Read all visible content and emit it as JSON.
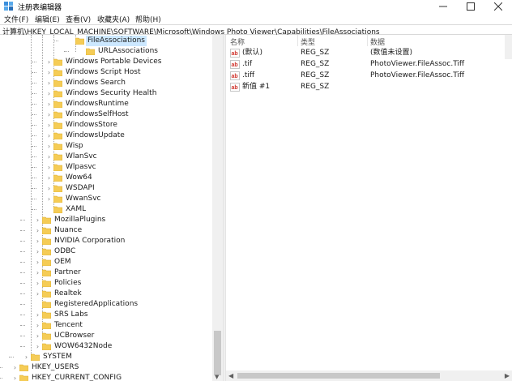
{
  "window": {
    "title": "注册表编辑器",
    "minimize_glyph": "—",
    "maximize_glyph": "☐",
    "close_glyph": "✕"
  },
  "menu": [
    "文件(F)",
    "编辑(E)",
    "查看(V)",
    "收藏夹(A)",
    "帮助(H)"
  ],
  "address": "计算机\\HKEY_LOCAL_MACHINE\\SOFTWARE\\Microsoft\\Windows Photo Viewer\\Capabilities\\FileAssociations",
  "tree": {
    "selected": "FileAssociations",
    "items": [
      {
        "label": "FileAssociations",
        "expander": ""
      },
      {
        "label": "URLAssociations",
        "expander": ""
      },
      {
        "label": "Windows Portable Devices",
        "expander": "›"
      },
      {
        "label": "Windows Script Host",
        "expander": "›"
      },
      {
        "label": "Windows Search",
        "expander": "›"
      },
      {
        "label": "Windows Security Health",
        "expander": "›"
      },
      {
        "label": "WindowsRuntime",
        "expander": "›"
      },
      {
        "label": "WindowsSelfHost",
        "expander": "›"
      },
      {
        "label": "WindowsStore",
        "expander": "›"
      },
      {
        "label": "WindowsUpdate",
        "expander": "›"
      },
      {
        "label": "Wisp",
        "expander": "›"
      },
      {
        "label": "WlanSvc",
        "expander": "›"
      },
      {
        "label": "Wlpasvc",
        "expander": "›"
      },
      {
        "label": "Wow64",
        "expander": "›"
      },
      {
        "label": "WSDAPI",
        "expander": "›"
      },
      {
        "label": "WwanSvc",
        "expander": "›"
      },
      {
        "label": "XAML",
        "expander": ""
      },
      {
        "label": "MozillaPlugins",
        "expander": "›"
      },
      {
        "label": "Nuance",
        "expander": "›"
      },
      {
        "label": "NVIDIA Corporation",
        "expander": "›"
      },
      {
        "label": "ODBC",
        "expander": "›"
      },
      {
        "label": "OEM",
        "expander": "›"
      },
      {
        "label": "Partner",
        "expander": "›"
      },
      {
        "label": "Policies",
        "expander": "›"
      },
      {
        "label": "Realtek",
        "expander": "›"
      },
      {
        "label": "RegisteredApplications",
        "expander": ""
      },
      {
        "label": "SRS Labs",
        "expander": "›"
      },
      {
        "label": "Tencent",
        "expander": "›"
      },
      {
        "label": "UCBrowser",
        "expander": "›"
      },
      {
        "label": "WOW6432Node",
        "expander": "›"
      },
      {
        "label": "SYSTEM",
        "expander": "›"
      },
      {
        "label": "HKEY_USERS",
        "expander": "›"
      },
      {
        "label": "HKEY_CURRENT_CONFIG",
        "expander": "›"
      }
    ]
  },
  "columns": {
    "name": "名称",
    "type": "类型",
    "data": "数据"
  },
  "values": [
    {
      "name": "(默认)",
      "type": "REG_SZ",
      "data": "(数值未设置)"
    },
    {
      "name": ".tif",
      "type": "REG_SZ",
      "data": "PhotoViewer.FileAssoc.Tiff"
    },
    {
      "name": ".tiff",
      "type": "REG_SZ",
      "data": "PhotoViewer.FileAssoc.Tiff"
    },
    {
      "name": "新值 #1",
      "type": "REG_SZ",
      "data": ""
    }
  ],
  "icons": {
    "app": "registry-editor-icon",
    "folder": "folder-icon",
    "string_value": "ab-string-value-icon"
  },
  "colors": {
    "selection": "#cce8ff",
    "folder": "#f5cc56",
    "value_icon": "#d0342c"
  }
}
